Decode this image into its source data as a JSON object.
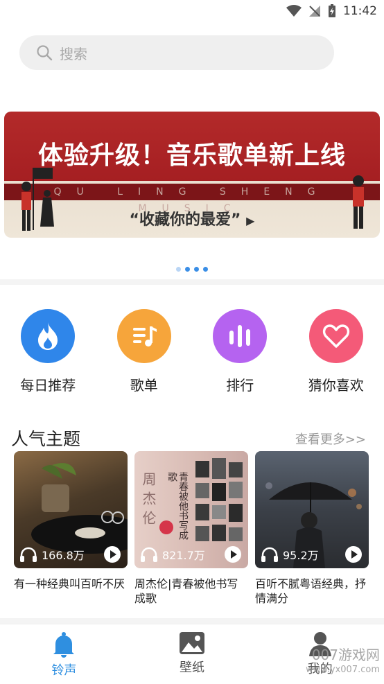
{
  "status_bar": {
    "time": "11:42"
  },
  "search": {
    "placeholder": "搜索"
  },
  "banner": {
    "title": "体验升级！音乐歌单新上线",
    "strip_text": "QU LING SHENG MUSIC",
    "subtitle": "“收藏你的最爱”",
    "page_count": 4,
    "active_page": 0
  },
  "categories": [
    {
      "label": "每日推荐",
      "icon": "flame-icon",
      "color": "#2f86ea"
    },
    {
      "label": "歌单",
      "icon": "playlist-icon",
      "color": "#f6a53b"
    },
    {
      "label": "排行",
      "icon": "ranking-bars-icon",
      "color": "#b563f0"
    },
    {
      "label": "猜你喜欢",
      "icon": "heart-icon",
      "color": "#f45a78"
    }
  ],
  "popular": {
    "title": "人气主题",
    "more_label": "查看更多>>",
    "cards": [
      {
        "plays": "166.8万",
        "title": "有一种经典叫百听不厌"
      },
      {
        "plays": "821.7万",
        "title": "周杰伦|青春被他书写成歌",
        "cover_text": "周杰伦",
        "cover_text2": "青春被他书写成歌"
      },
      {
        "plays": "95.2万",
        "title": "百听不腻粤语经典，抒情满分"
      }
    ]
  },
  "tabs": [
    {
      "label": "铃声",
      "icon": "bell-icon",
      "active": true
    },
    {
      "label": "壁纸",
      "icon": "image-icon",
      "active": false
    },
    {
      "label": "我的",
      "icon": "user-icon",
      "active": false
    }
  ],
  "watermark": {
    "line1": "007游戏网",
    "line2": "www.yx007.com"
  },
  "colors": {
    "accent": "#2f8fe0",
    "banner_red": "#a51f22"
  }
}
